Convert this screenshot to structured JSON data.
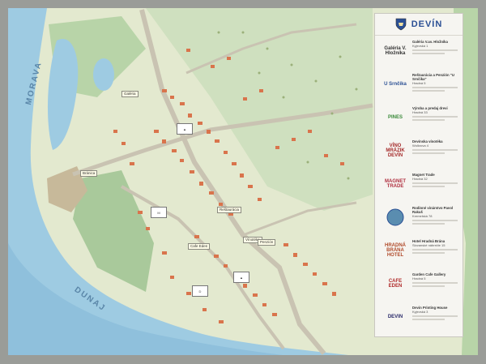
{
  "panel": {
    "title": "DEVÍN",
    "entries": [
      {
        "logo_text": "Galéria V. Hložníka",
        "name": "Galéria V.av. Hložníka",
        "address": "Kyjevská 1",
        "logo_color": "#333333"
      },
      {
        "logo_text": "U Srnčíka",
        "name": "Reštaurácia a Penzión \"U Srnčíka\"",
        "address": "Hradná 5",
        "logo_color": "#2a4f94"
      },
      {
        "logo_text": "PINES",
        "name": "Výroba a predaj drevi",
        "address": "Hradná 33",
        "logo_color": "#3a8a3a"
      },
      {
        "logo_text": "VÍNO MRÁZIK DEVÍN",
        "name": "Devínska vínotéka",
        "address": "Wolkrova 4",
        "logo_color": "#a52a2a"
      },
      {
        "logo_text": "MAGNET TRADE",
        "name": "Magnet Trade",
        "address": "Hradná 32",
        "logo_color": "#b03040"
      },
      {
        "logo_text": "",
        "name": "Rodinné vinárstvo Pavol Rakuš",
        "address": "Kremelská 78",
        "logo_color": "#5a8db0"
      },
      {
        "logo_text": "HRADNÁ BRÁNA HOTEL",
        "name": "Hotel Hradná Brána",
        "address": "Slovanské nábrežie 15",
        "logo_color": "#b04a2a"
      },
      {
        "logo_text": "CAFE EDEN",
        "name": "Garden Cafe Gallery",
        "address": "Hradná 5",
        "logo_color": "#b02a2a"
      },
      {
        "logo_text": "DEVIN",
        "name": "Devin Printing House",
        "address": "Kyjevská 3",
        "logo_color": "#2a2a6a"
      }
    ]
  },
  "map": {
    "rivers": {
      "morava": "MORAVA",
      "dunaj": "DUNAJ"
    },
    "pins": [
      "Vínotéka",
      "Cafe Eden",
      "Reštaurácia",
      "Penzión",
      "Bránica",
      "Galéria"
    ],
    "colors": {
      "water": "#9ecbe2",
      "river_deep": "#6aa2c8",
      "land": "#e3e9cf",
      "forest": "#a9c99b",
      "road": "#c9c3b2",
      "roof": "#d9744c",
      "panel_accent": "#2a4f94"
    }
  }
}
